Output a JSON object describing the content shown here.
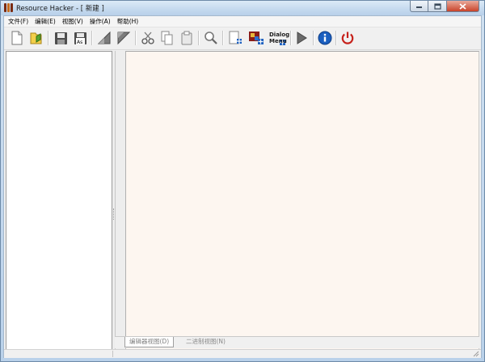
{
  "window": {
    "title": "Resource Hacker - [ 新建 ]"
  },
  "menu": [
    {
      "label": "文件(F)"
    },
    {
      "label": "编辑(E)"
    },
    {
      "label": "视图(V)"
    },
    {
      "label": "操作(A)"
    },
    {
      "label": "帮助(H)"
    }
  ],
  "toolbar": {
    "dialog_menu_label_line1": "Dialog",
    "dialog_menu_label_line2": "Menu"
  },
  "tabs": {
    "editor_view": "编辑器视图(D)",
    "binary_view": "二进制视图(N)"
  },
  "colors": {
    "editor_background": "#fdf6f0",
    "tree_background": "#ffffff",
    "accent_blue": "#1b5fbf",
    "power_red": "#c6211b"
  },
  "icons": [
    "new-file-icon",
    "open-file-icon",
    "save-icon",
    "save-as-icon",
    "back-icon",
    "forward-icon",
    "cut-icon",
    "copy-icon",
    "paste-icon",
    "find-icon",
    "add-resource-icon",
    "add-image-icon",
    "dialog-menu-icon",
    "compile-run-icon",
    "info-icon",
    "power-icon"
  ]
}
